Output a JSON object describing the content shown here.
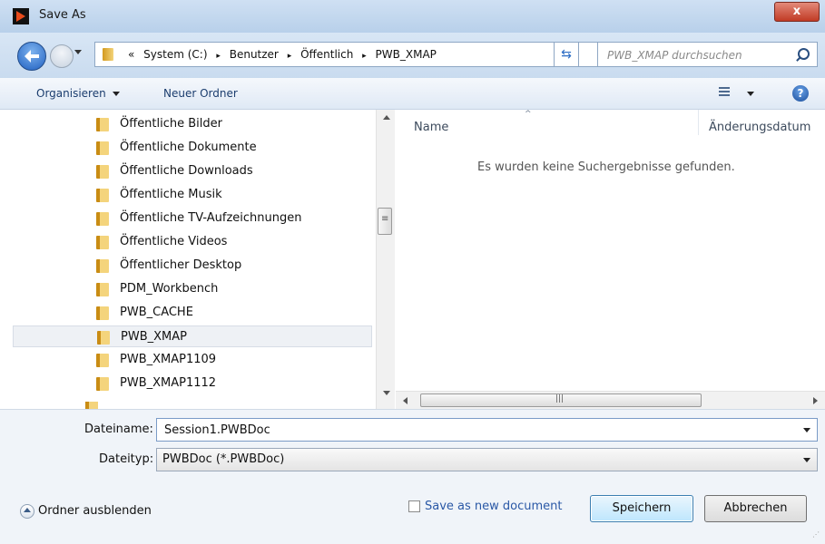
{
  "window": {
    "title": "Save As",
    "close_symbol": "x"
  },
  "address": {
    "overflow": "«",
    "crumbs": [
      "System (C:)",
      "Benutzer",
      "Öffentlich",
      "PWB_XMAP"
    ],
    "separator": "▸"
  },
  "search": {
    "placeholder": "PWB_XMAP durchsuchen"
  },
  "toolbar": {
    "organize": "Organisieren",
    "new_folder": "Neuer Ordner",
    "help": "?"
  },
  "nav": {
    "items": [
      "Öffentliche Bilder",
      "Öffentliche Dokumente",
      "Öffentliche Downloads",
      "Öffentliche Musik",
      "Öffentliche TV-Aufzeichnungen",
      "Öffentliche Videos",
      "Öffentlicher Desktop",
      "PDM_Workbench",
      "PWB_CACHE",
      "PWB_XMAP",
      "PWB_XMAP1109",
      "PWB_XMAP1112"
    ],
    "selected": "PWB_XMAP"
  },
  "list": {
    "columns": [
      "Name",
      "Änderungsdatum"
    ],
    "empty_message": "Es wurden keine Suchergebnisse gefunden."
  },
  "form": {
    "filename_label": "Dateiname:",
    "filename_value": "Session1.PWBDoc",
    "filetype_label": "Dateityp:",
    "filetype_value": "PWBDoc (*.PWBDoc)"
  },
  "footer": {
    "hide_folders": "Ordner ausblenden",
    "save_as_new": "Save as new document",
    "save_as_new_checked": false,
    "save_button": "Speichern",
    "cancel_button": "Abbrechen"
  }
}
